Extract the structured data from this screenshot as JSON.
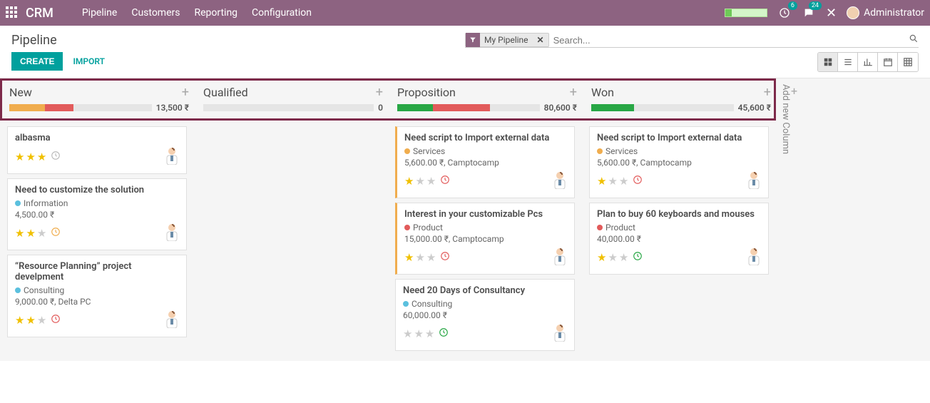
{
  "navbar": {
    "brand": "CRM",
    "menu": [
      "Pipeline",
      "Customers",
      "Reporting",
      "Configuration"
    ],
    "badge1": "6",
    "badge2": "24",
    "user": "Administrator"
  },
  "control": {
    "breadcrumb": "Pipeline",
    "create": "CREATE",
    "import": "IMPORT",
    "facet": "My Pipeline",
    "search_placeholder": "Search..."
  },
  "columns": [
    {
      "title": "New",
      "total": "13,500 ₹",
      "bar": [
        {
          "cls": "seg-orange",
          "w": "25%"
        },
        {
          "cls": "seg-red",
          "w": "20%"
        }
      ],
      "cards": [
        {
          "title": "albasma",
          "tags": [],
          "amount": "",
          "stars": 3,
          "clock": "grey",
          "stripe": ""
        },
        {
          "title": "Need to customize the solution",
          "tags": [
            {
              "dot": "dot-blue",
              "label": "Information"
            }
          ],
          "amount": "4,500.00 ₹",
          "stars": 2,
          "clock": "orange",
          "stripe": ""
        },
        {
          "title": "“Resource Planning” project develpment",
          "tags": [
            {
              "dot": "dot-blue",
              "label": "Consulting"
            }
          ],
          "amount": "9,000.00 ₹, Delta PC",
          "stars": 2,
          "clock": "red",
          "stripe": ""
        }
      ]
    },
    {
      "title": "Qualified",
      "total": "0",
      "bar": [],
      "cards": []
    },
    {
      "title": "Proposition",
      "total": "80,600 ₹",
      "bar": [
        {
          "cls": "seg-green",
          "w": "25%"
        },
        {
          "cls": "seg-red",
          "w": "40%"
        }
      ],
      "cards": [
        {
          "title": "Need script to Import external data",
          "tags": [
            {
              "dot": "dot-yellow",
              "label": "Services"
            }
          ],
          "amount": "5,600.00 ₹, Camptocamp",
          "stars": 1,
          "clock": "red",
          "stripe": "stripe-yellow"
        },
        {
          "title": "Interest in your customizable Pcs",
          "tags": [
            {
              "dot": "dot-red",
              "label": "Product"
            }
          ],
          "amount": "15,000.00 ₹, Camptocamp",
          "stars": 1,
          "clock": "red",
          "stripe": "stripe-yellow"
        },
        {
          "title": "Need 20 Days of Consultancy",
          "tags": [
            {
              "dot": "dot-blue",
              "label": "Consulting"
            }
          ],
          "amount": "60,000.00 ₹",
          "stars": 0,
          "clock": "green",
          "stripe": ""
        }
      ]
    },
    {
      "title": "Won",
      "total": "45,600 ₹",
      "bar": [
        {
          "cls": "seg-green",
          "w": "30%"
        }
      ],
      "cards": [
        {
          "title": "Need script to Import external data",
          "tags": [
            {
              "dot": "dot-yellow",
              "label": "Services"
            }
          ],
          "amount": "5,600.00 ₹, Camptocamp",
          "stars": 1,
          "clock": "red",
          "stripe": ""
        },
        {
          "title": "Plan to buy 60 keyboards and mouses",
          "tags": [
            {
              "dot": "dot-red",
              "label": "Product"
            }
          ],
          "amount": "40,000.00 ₹",
          "stars": 1,
          "clock": "green",
          "stripe": ""
        }
      ]
    }
  ],
  "add_column": "Add new Column"
}
